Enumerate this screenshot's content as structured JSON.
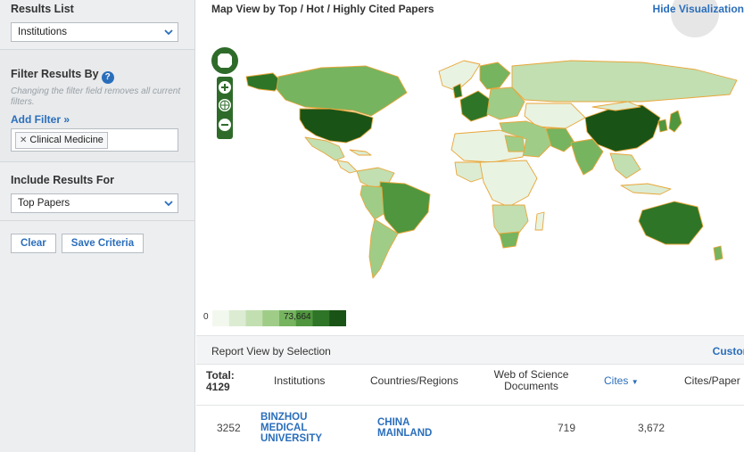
{
  "sidebar": {
    "results_list": {
      "title": "Results List",
      "selected": "Institutions"
    },
    "filter": {
      "title": "Filter Results By",
      "hint": "Changing the filter field removes all current filters.",
      "add_filter": "Add Filter »",
      "chips": [
        {
          "label": "Clinical Medicine"
        }
      ]
    },
    "include": {
      "title": "Include Results For",
      "selected": "Top Papers"
    },
    "buttons": {
      "clear": "Clear",
      "save": "Save Criteria"
    }
  },
  "map": {
    "title": "Map View by Top / Hot / Highly Cited Papers",
    "hide_link": "Hide Visualization",
    "legend": {
      "min": "0",
      "max": "73,664"
    },
    "colors": [
      "#f3f8ef",
      "#dcecd2",
      "#c2dfb1",
      "#9fcd88",
      "#76b45f",
      "#4f963e",
      "#2e7527",
      "#1a5316"
    ]
  },
  "report": {
    "title": "Report View by Selection",
    "custom_link": "Custon",
    "columns": {
      "total_label": "Total:",
      "total_value": "4129",
      "institutions": "Institutions",
      "countries": "Countries/Regions",
      "wos_line1": "Web of Science",
      "wos_line2": "Documents",
      "cites": "Cites",
      "cites_paper": "Cites/Paper"
    },
    "rows": [
      {
        "rank": "3252",
        "institution_lines": [
          "BINZHOU",
          "MEDICAL",
          "UNIVERSITY"
        ],
        "country_lines": [
          "CHINA",
          "MAINLAND"
        ],
        "wos_docs": "719",
        "cites": "3,672"
      }
    ]
  }
}
